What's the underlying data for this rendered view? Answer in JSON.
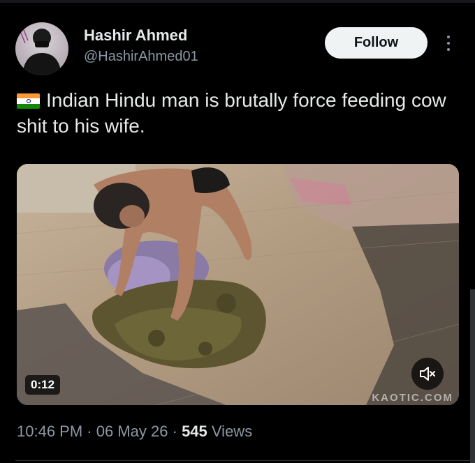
{
  "author": {
    "name": "Hashir Ahmed",
    "handle": "@HashirAhmed01",
    "avatar_icon": "user-avatar"
  },
  "actions": {
    "follow_label": "Follow",
    "more_icon": "more-vertical-icon"
  },
  "post": {
    "flag_icon": "india-flag-icon",
    "text": "Indian Hindu man is brutally force feeding cow shit to his wife."
  },
  "media": {
    "type": "video",
    "duration": "0:12",
    "watermark": "KAOTIC.COM",
    "mute_icon": "volume-muted-icon"
  },
  "meta": {
    "time": "10:46 PM",
    "separator": "·",
    "date": "06 May 26",
    "views_count": "545",
    "views_label": "Views"
  },
  "colors": {
    "background": "#000000",
    "text_primary": "#e7e9ea",
    "text_secondary": "#8b98a5",
    "follow_bg": "#eff3f4"
  }
}
